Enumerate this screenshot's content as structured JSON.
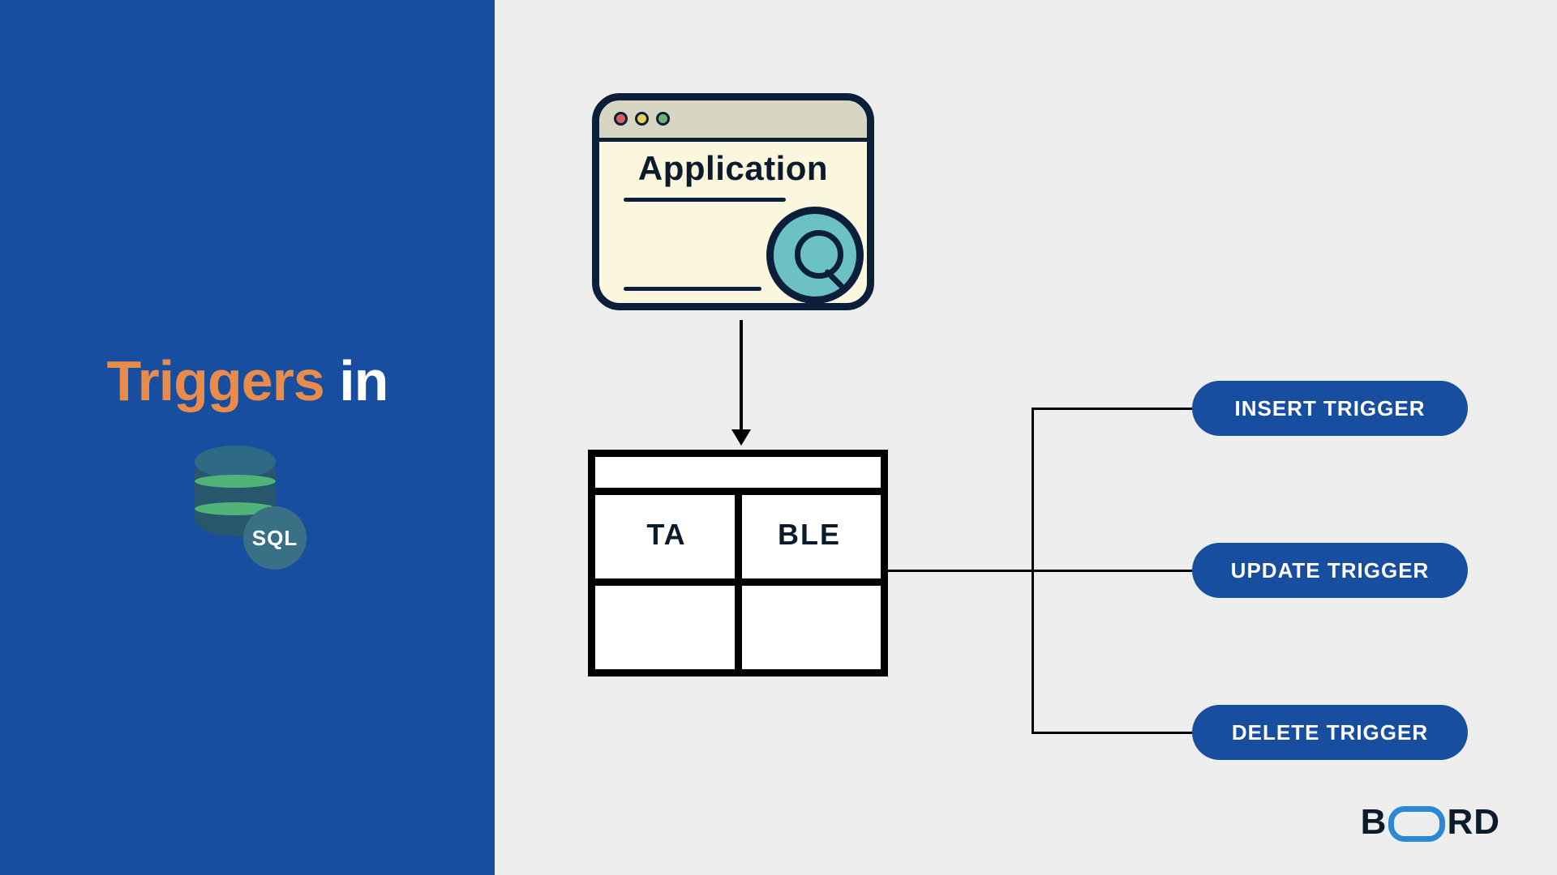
{
  "title": {
    "emphasis": "Triggers",
    "rest": "in"
  },
  "sql_badge": "SQL",
  "app_window": {
    "label": "Application"
  },
  "table": {
    "left": "TA",
    "right": "BLE"
  },
  "triggers": [
    "INSERT TRIGGER",
    "UPDATE TRIGGER",
    "DELETE TRIGGER"
  ],
  "brand": {
    "left": "B",
    "right": "RD"
  },
  "colors": {
    "panel": "#174ea0",
    "accent": "#e98b4a",
    "pill": "#174ea0",
    "teal": "#6cc1c5"
  }
}
